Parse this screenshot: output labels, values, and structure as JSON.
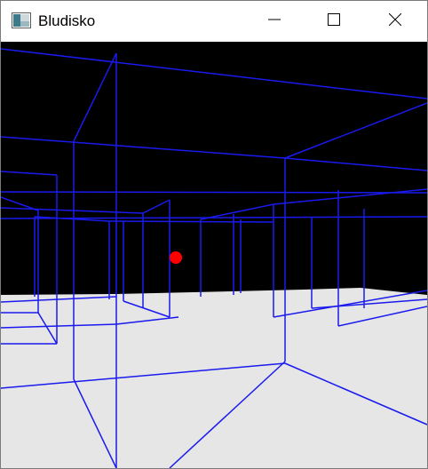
{
  "window": {
    "title": "Bludisko",
    "icon": "app-window-icon",
    "controls": {
      "minimize_icon": "minimize-icon",
      "maximize_icon": "maximize-icon",
      "close_icon": "close-icon"
    }
  },
  "scene": {
    "sky_color": "#000000",
    "floor_color": "#e6e6e6",
    "wall_line_color": "#1a1aee",
    "marker_color": "#ff0000"
  }
}
